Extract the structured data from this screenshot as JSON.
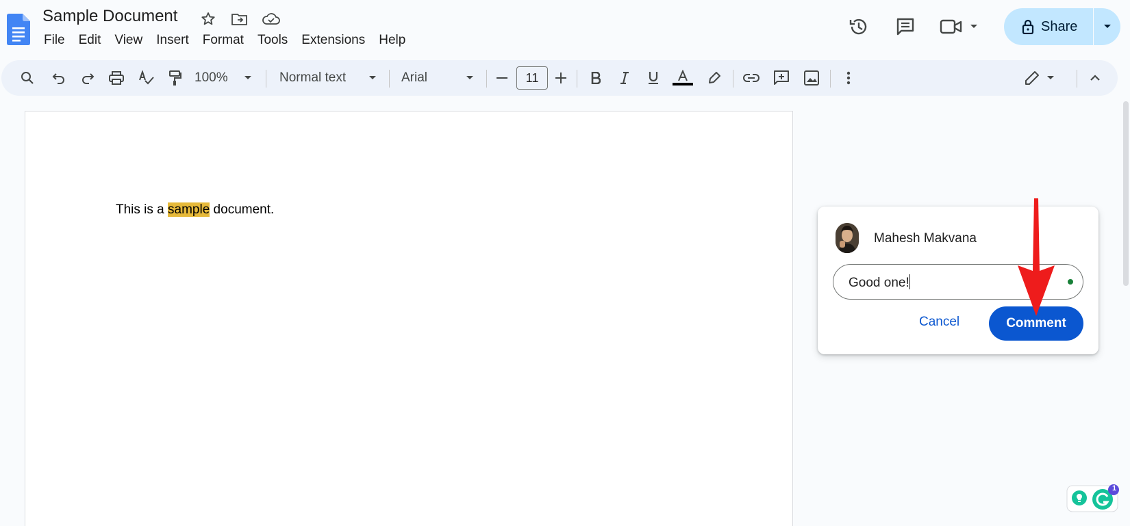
{
  "document": {
    "title": "Sample Document",
    "body_before": "This is a ",
    "body_highlight": "sample",
    "body_after": " document."
  },
  "menu": [
    "File",
    "Edit",
    "View",
    "Insert",
    "Format",
    "Tools",
    "Extensions",
    "Help"
  ],
  "share": {
    "label": "Share"
  },
  "toolbar": {
    "zoom": "100%",
    "style": "Normal text",
    "font": "Arial",
    "font_size": "11"
  },
  "comment": {
    "author": "Mahesh Makvana",
    "input_value": "Good one!",
    "cancel_label": "Cancel",
    "submit_label": "Comment"
  },
  "grammarly": {
    "badge_count": "1"
  },
  "colors": {
    "accent": "#0b57d0",
    "share_bg": "#c2e7ff",
    "toolbar_bg": "#edf2fa",
    "highlight": "#e6b93a",
    "annotation_arrow": "#ee1c1c"
  }
}
